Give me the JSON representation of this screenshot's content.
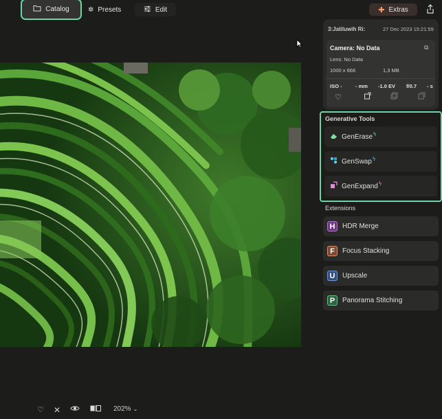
{
  "toolbar": {
    "catalog": "Catalog",
    "presets": "Presets",
    "edit": "Edit",
    "extras": "Extras"
  },
  "info": {
    "filename": "3:Jatiluwih Ri:",
    "date": "27 Dec 2023 15:21:59",
    "camera": "Camera: No Data",
    "lens": "Lens: No Data",
    "dimensions": "1000 x 666",
    "filesize": "1,3 MB",
    "iso": "ISO -",
    "focal": "- mm",
    "ev": "-1.0 EV",
    "aperture": "f/0.7",
    "shutter": "- s"
  },
  "generative": {
    "title": "Generative Tools",
    "tools": [
      {
        "label": "GenErase",
        "accent": "#7fe0a0"
      },
      {
        "label": "GenSwap",
        "accent": "#5fc8e8"
      },
      {
        "label": "GenExpand",
        "accent": "#e08ad8"
      }
    ]
  },
  "extensions": {
    "title": "Extensions",
    "items": [
      {
        "letter": "H",
        "label": "HDR Merge",
        "color": "#a05ab8"
      },
      {
        "letter": "F",
        "label": "Focus Stacking",
        "color": "#d0744a"
      },
      {
        "letter": "U",
        "label": "Upscale",
        "color": "#4a7ad0"
      },
      {
        "letter": "P",
        "label": "Panorama Stitching",
        "color": "#4aa068"
      }
    ]
  },
  "bottom": {
    "zoom": "202%"
  },
  "colors": {
    "highlight": "#6cd6a4",
    "background": "#1c1c1a",
    "panel": "#2a2a28"
  }
}
